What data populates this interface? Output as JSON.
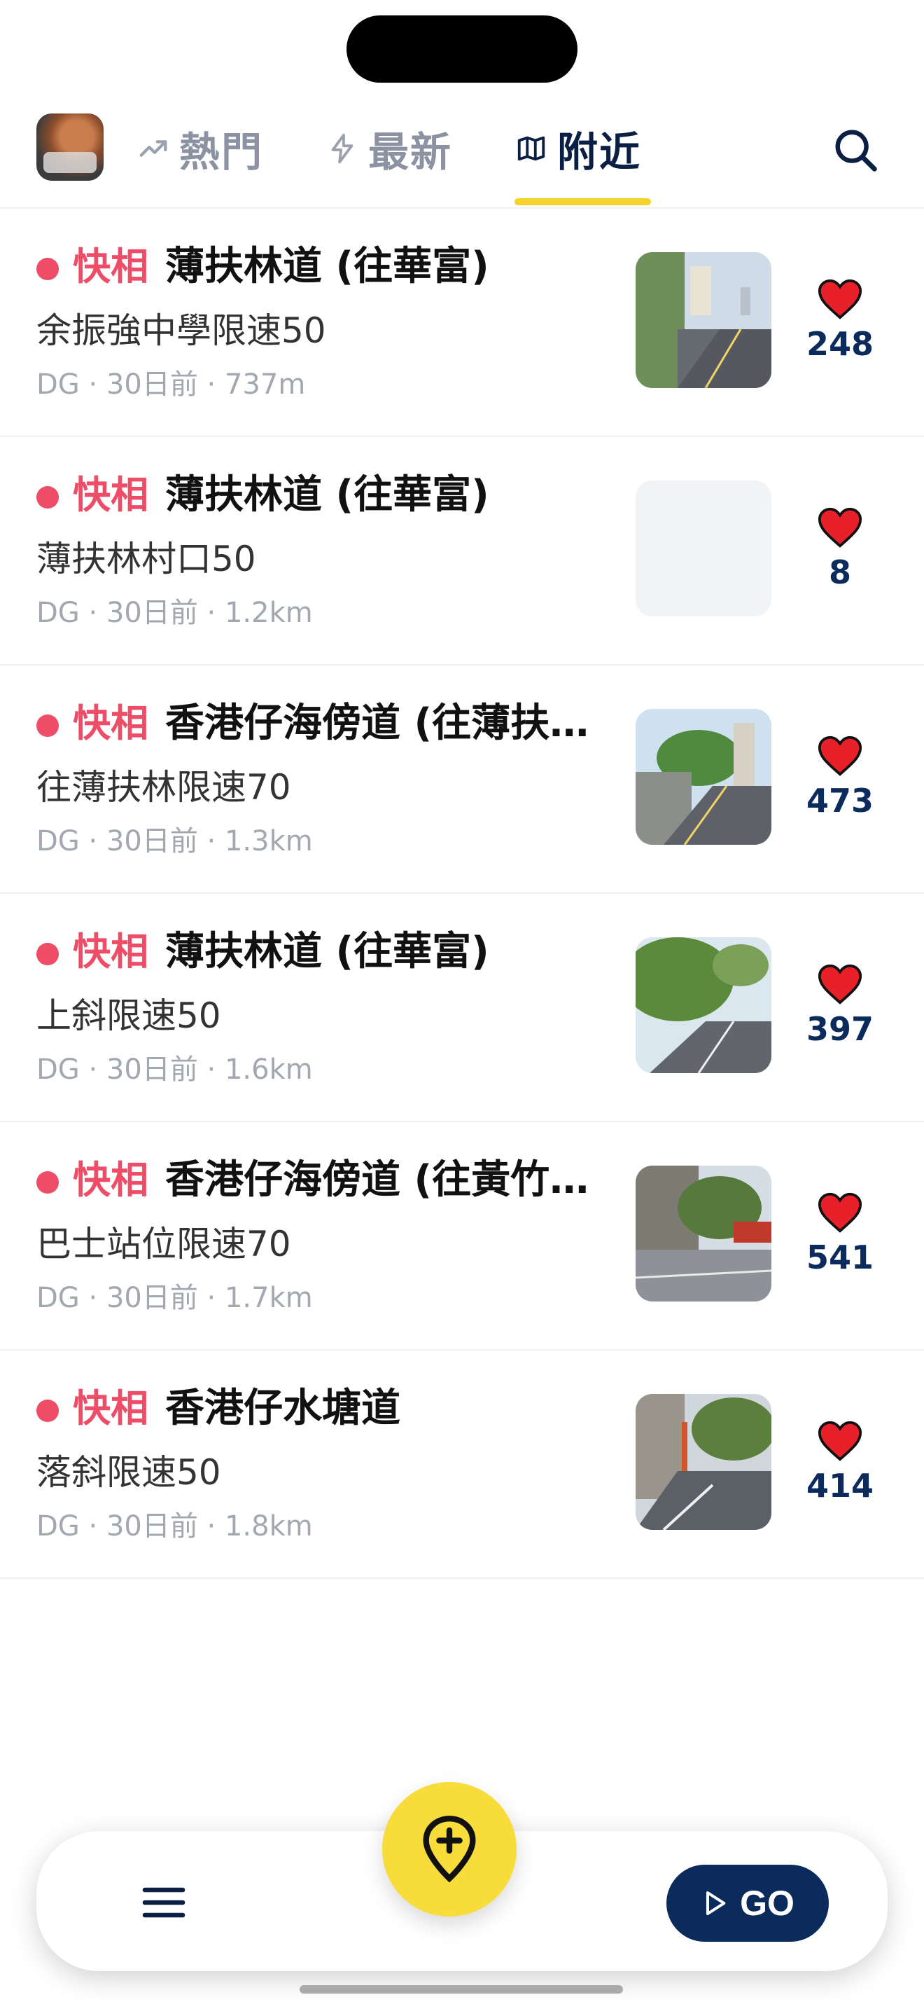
{
  "header": {
    "tabs": [
      {
        "label": "熱門",
        "icon": "trending-up-icon",
        "active": false
      },
      {
        "label": "最新",
        "icon": "lightning-icon",
        "active": false
      },
      {
        "label": "附近",
        "icon": "map-icon",
        "active": true
      }
    ],
    "accent_color": "#f7d22a"
  },
  "items": [
    {
      "tag": "快相",
      "title": "薄扶林道 (往華富)",
      "subtitle": "余振強中學限速50",
      "meta": "DG · 30日前 · 737m",
      "likes": "248",
      "has_photo": true
    },
    {
      "tag": "快相",
      "title": "薄扶林道 (往華富)",
      "subtitle": "薄扶林村口50",
      "meta": "DG · 30日前 · 1.2km",
      "likes": "8",
      "has_photo": false
    },
    {
      "tag": "快相",
      "title": "香港仔海傍道 (往薄扶…",
      "subtitle": "往薄扶林限速70",
      "meta": "DG · 30日前 · 1.3km",
      "likes": "473",
      "has_photo": true
    },
    {
      "tag": "快相",
      "title": "薄扶林道 (往華富)",
      "subtitle": "上斜限速50",
      "meta": "DG · 30日前 · 1.6km",
      "likes": "397",
      "has_photo": true
    },
    {
      "tag": "快相",
      "title": "香港仔海傍道 (往黃竹…",
      "subtitle": "巴士站位限速70",
      "meta": "DG · 30日前 · 1.7km",
      "likes": "541",
      "has_photo": true
    },
    {
      "tag": "快相",
      "title": "香港仔水塘道",
      "subtitle": "落斜限速50",
      "meta": "DG · 30日前 · 1.8km",
      "likes": "414",
      "has_photo": true
    }
  ],
  "bottom": {
    "go_label": "GO",
    "go_color": "#0b2b5c",
    "fab_color": "#f8dc3b"
  },
  "colors": {
    "tag": "#ef4c67",
    "like": "#e8202a"
  }
}
